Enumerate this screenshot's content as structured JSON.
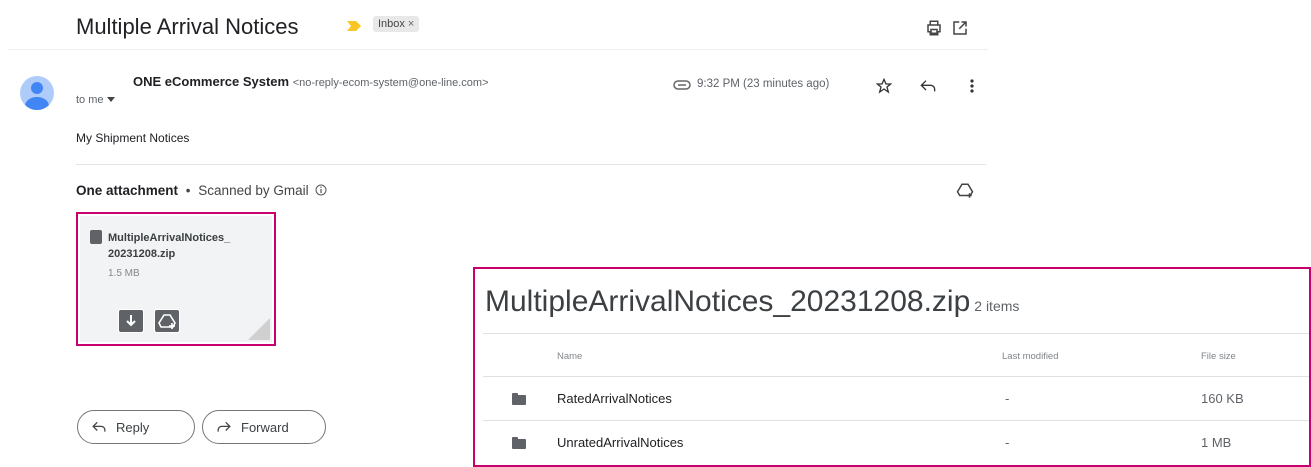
{
  "email": {
    "subject": "Multiple Arrival Notices",
    "label": "Inbox",
    "label_close": "×",
    "sender_name": "ONE eCommerce System",
    "sender_email": "<no-reply-ecom-system@one-line.com>",
    "recipient": "to me",
    "time": "9:32 PM (23 minutes ago)",
    "body": "My Shipment Notices"
  },
  "attachments": {
    "title": "One attachment",
    "scanned": "Scanned by Gmail",
    "separator": "•",
    "file_name_line1": "MultipleArrivalNotices_",
    "file_name_line2": "20231208.zip",
    "file_size": "1.5 MB"
  },
  "actions": {
    "reply": "Reply",
    "forward": "Forward"
  },
  "zip_preview": {
    "title": "MultipleArrivalNotices_20231208.zip",
    "count": "2 items",
    "columns": {
      "name": "Name",
      "modified": "Last modified",
      "size": "File size"
    },
    "rows": [
      {
        "name": "RatedArrivalNotices",
        "modified": "-",
        "size": "160 KB"
      },
      {
        "name": "UnratedArrivalNotices",
        "modified": "-",
        "size": "1 MB"
      }
    ]
  },
  "colors": {
    "highlight": "#c8006e",
    "important": "#f9c623",
    "avatar": "#aecbfa"
  },
  "icons": [
    "important-marker-icon",
    "print-icon",
    "open-in-new-window-icon",
    "avatar-person-icon",
    "label-icon",
    "star-icon",
    "reply-icon",
    "more-vert-icon",
    "add-to-drive-icon",
    "file-icon",
    "download-icon",
    "forward-icon",
    "folder-icon"
  ]
}
